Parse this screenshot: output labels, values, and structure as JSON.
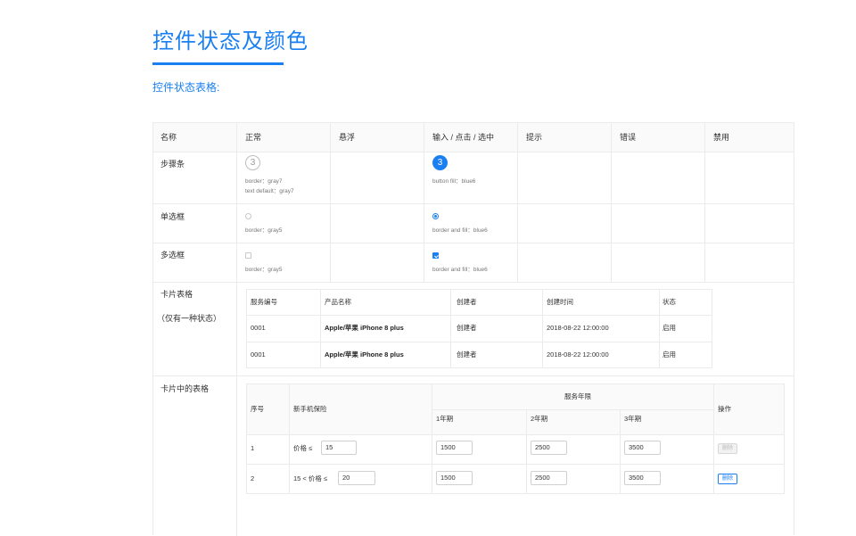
{
  "page": {
    "title": "控件状态及颜色",
    "section_label": "控件状态表格:",
    "accent": "#1a7ff0"
  },
  "grid": {
    "headers": [
      "名称",
      "正常",
      "悬浮",
      "输入 / 点击 / 选中",
      "提示",
      "错误",
      "禁用"
    ],
    "rows": {
      "stepper": {
        "name": "步骤条",
        "normal_value": "3",
        "normal_note_1": "border：gray7",
        "normal_note_2": "text default：gray7",
        "active_value": "3",
        "active_note": "button fill：blue6"
      },
      "radio": {
        "name": "单选框",
        "normal_note": "border：gray5",
        "active_note": "border and fill：blue6"
      },
      "checkbox": {
        "name": "多选框",
        "normal_note": "border：gray5",
        "active_note": "border and fill：blue6"
      },
      "card_table": {
        "name": "卡片表格",
        "sub_name": "（仅有一种状态）"
      },
      "table_in_card": {
        "name": "卡片中的表格"
      }
    }
  },
  "card_table": {
    "headers": [
      "服务编号",
      "产品名称",
      "创建者",
      "创建时间",
      "状态"
    ],
    "rows": [
      [
        "0001",
        "Apple/苹果 iPhone 8 plus",
        "创建者",
        "2018-08-22  12:00:00",
        "启用"
      ],
      [
        "0001",
        "Apple/苹果 iPhone 8 plus",
        "创建者",
        "2018-08-22  12:00:00",
        "启用"
      ]
    ]
  },
  "inner_table": {
    "col_index": "序号",
    "col_insurance": "新手机保险",
    "col_group": "服务年限",
    "col_years": [
      "1年期",
      "2年期",
      "3年期"
    ],
    "col_action": "操作",
    "rows": [
      {
        "index": "1",
        "condition_prefix": "价格  ≤",
        "condition_value": "15",
        "values": [
          "1500",
          "2500",
          "3500"
        ],
        "action": "删除",
        "action_disabled": true
      },
      {
        "index": "2",
        "condition_prefix": "15  <  价格  ≤",
        "condition_value": "20",
        "values": [
          "1500",
          "2500",
          "3500"
        ],
        "action": "删除",
        "action_disabled": false
      }
    ]
  }
}
